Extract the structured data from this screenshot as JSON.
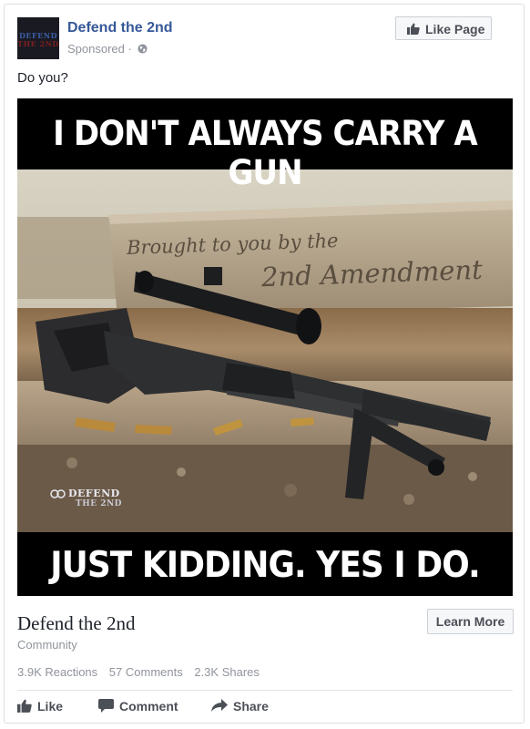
{
  "post": {
    "page_name": "Defend the 2nd",
    "sponsored_label": "Sponsored",
    "separator": "·",
    "message": "Do you?",
    "like_page_label": "Like Page",
    "avatar_text": [
      "DEFEND",
      "THE 2ND"
    ]
  },
  "ad_image": {
    "caption_top": "I DON'T ALWAYS CARRY A GUN",
    "stone_line1": "Brought to you by the",
    "stone_line2": "2nd Amendment",
    "watermark_line1": "DEFEND",
    "watermark_line2": "THE 2ND",
    "caption_bottom": "JUST KIDDING. YES I DO."
  },
  "link": {
    "title": "Defend the 2nd",
    "subtitle": "Community",
    "cta_label": "Learn More"
  },
  "stats": {
    "reactions": "3.9K Reactions",
    "comments": "57 Comments",
    "shares": "2.3K Shares"
  },
  "actions": {
    "like": "Like",
    "comment": "Comment",
    "share": "Share"
  },
  "colors": {
    "page_name": "#365899",
    "secondary_text": "#90949c",
    "action_text": "#4b4f56"
  },
  "icons": {
    "globe": "globe-icon",
    "thumb": "thumbs-up-icon",
    "comment": "comment-icon",
    "share": "share-arrow-icon"
  }
}
